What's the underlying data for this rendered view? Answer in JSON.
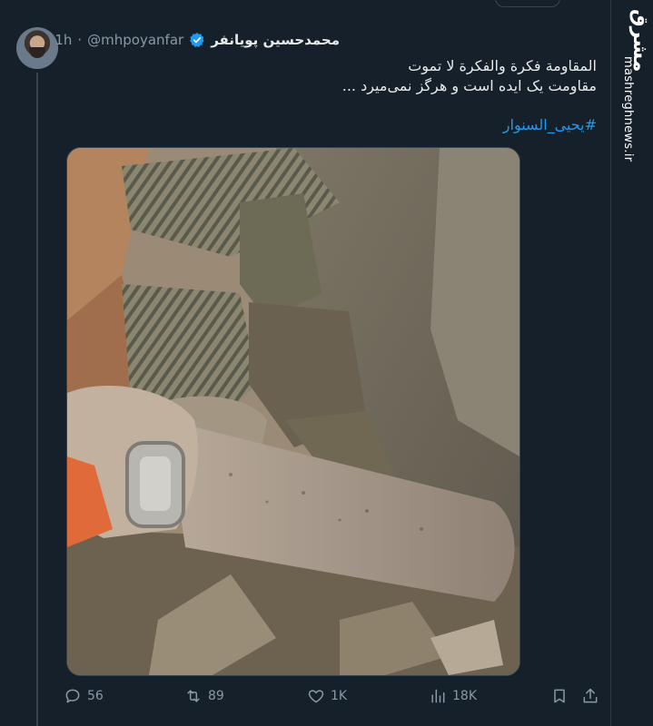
{
  "tweet": {
    "display_name": "محمدحسین پویانفر",
    "handle": "@mhpoyanfar",
    "separator": "·",
    "time": "1h",
    "text_line1": "المقاومة فكرة والفكرة لا تموت",
    "text_line2": "مقاومت یک ایده است و هرگز نمی‌میرد ...",
    "hashtag": "#یحیی_السنوار"
  },
  "actions": {
    "replies": "56",
    "retweets": "89",
    "likes": "1K",
    "views": "18K"
  },
  "icons": {
    "verified": "verified-badge-icon",
    "reply": "reply-icon",
    "retweet": "retweet-icon",
    "like": "heart-icon",
    "views": "views-icon",
    "bookmark": "bookmark-icon",
    "share": "share-icon"
  },
  "watermark": {
    "logo": "مشرق",
    "url": "mashreghnews.ir"
  },
  "colors": {
    "background": "#15202b",
    "text": "#e7e9ea",
    "secondary": "#8b98a5",
    "link": "#1d9bf0"
  }
}
